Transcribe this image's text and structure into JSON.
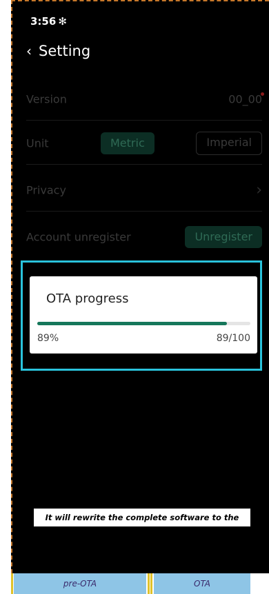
{
  "status_bar": {
    "time": "3:56",
    "bluetooth": "✻"
  },
  "header": {
    "back_icon": "‹",
    "title": "Setting"
  },
  "settings": {
    "version": {
      "label": "Version",
      "value": "00_00"
    },
    "unit": {
      "label": "Unit",
      "metric": "Metric",
      "imperial": "Imperial"
    },
    "privacy": {
      "label": "Privacy",
      "chevron": "›"
    },
    "account": {
      "label": "Account unregister",
      "button": "Unregister"
    }
  },
  "ota_dialog": {
    "title": "OTA progress",
    "percent_text": "89%",
    "count_text": "89/100",
    "progress": 0.89
  },
  "caption": "It will rewrite the complete software to the controller",
  "bottom_tabs": [
    "pre-OTA",
    "OTA"
  ],
  "colors": {
    "accent": "#16775b",
    "highlight": "#2ac3dc",
    "dash": "#c8782a"
  }
}
